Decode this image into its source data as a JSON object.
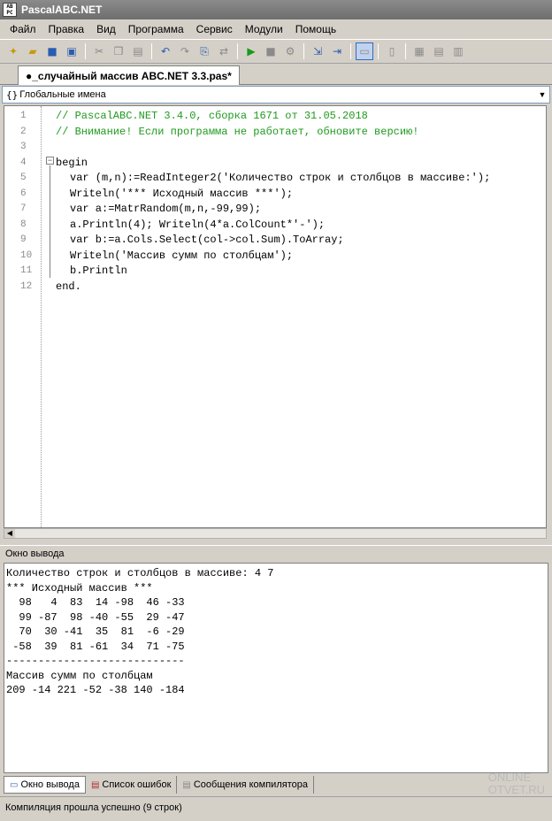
{
  "window": {
    "title": "PascalABC.NET",
    "icon_text": "AB PC"
  },
  "menu": [
    "Файл",
    "Правка",
    "Вид",
    "Программа",
    "Сервис",
    "Модули",
    "Помощь"
  ],
  "file_tab": {
    "label": "●_случайный массив ABC.NET 3.3.pas*"
  },
  "scope_combo": {
    "icon": "{}",
    "value": "Глобальные имена"
  },
  "editor": {
    "lines": [
      {
        "num": "1",
        "code": "// PascalABC.NET 3.4.0, сборка 1671 от 31.05.2018",
        "type": "comment",
        "indent": 0
      },
      {
        "num": "2",
        "code": "// Внимание! Если программа не работает, обновите версию!",
        "type": "comment",
        "indent": 0
      },
      {
        "num": "3",
        "code": "",
        "type": "code",
        "indent": 0
      },
      {
        "num": "4",
        "code": "begin",
        "type": "code",
        "indent": 0
      },
      {
        "num": "5",
        "code": "var (m,n):=ReadInteger2('Количество строк и столбцов в массиве:');",
        "type": "code",
        "indent": 2
      },
      {
        "num": "6",
        "code": "Writeln('*** Исходный массив ***');",
        "type": "code",
        "indent": 2
      },
      {
        "num": "7",
        "code": "var a:=MatrRandom(m,n,-99,99);",
        "type": "code",
        "indent": 2
      },
      {
        "num": "8",
        "code": "a.Println(4); Writeln(4*a.ColCount*'-');",
        "type": "code",
        "indent": 2
      },
      {
        "num": "9",
        "code": "var b:=a.Cols.Select(col->col.Sum).ToArray;",
        "type": "code",
        "indent": 2
      },
      {
        "num": "10",
        "code": "Writeln('Массив сумм по столбцам');",
        "type": "code",
        "indent": 2
      },
      {
        "num": "11",
        "code": "b.Println",
        "type": "code",
        "indent": 2
      },
      {
        "num": "12",
        "code": "end.",
        "type": "code",
        "indent": 0
      }
    ]
  },
  "output_panel": {
    "header": "Окно вывода",
    "lines": [
      "Количество строк и столбцов в массиве: 4 7",
      "*** Исходный массив ***",
      "  98   4  83  14 -98  46 -33",
      "  99 -87  98 -40 -55  29 -47",
      "  70  30 -41  35  81  -6 -29",
      " -58  39  81 -61  34  71 -75",
      "----------------------------",
      "Массив сумм по столбцам",
      "209 -14 221 -52 -38 140 -184"
    ]
  },
  "bottom_tabs": [
    {
      "label": "Окно вывода",
      "active": true
    },
    {
      "label": "Список ошибок",
      "active": false
    },
    {
      "label": "Сообщения компилятора",
      "active": false
    }
  ],
  "watermark": {
    "line1": "ONLINE",
    "line2": "OTVET.RU"
  },
  "status": {
    "text": "Компиляция прошла успешно (9 строк)"
  }
}
